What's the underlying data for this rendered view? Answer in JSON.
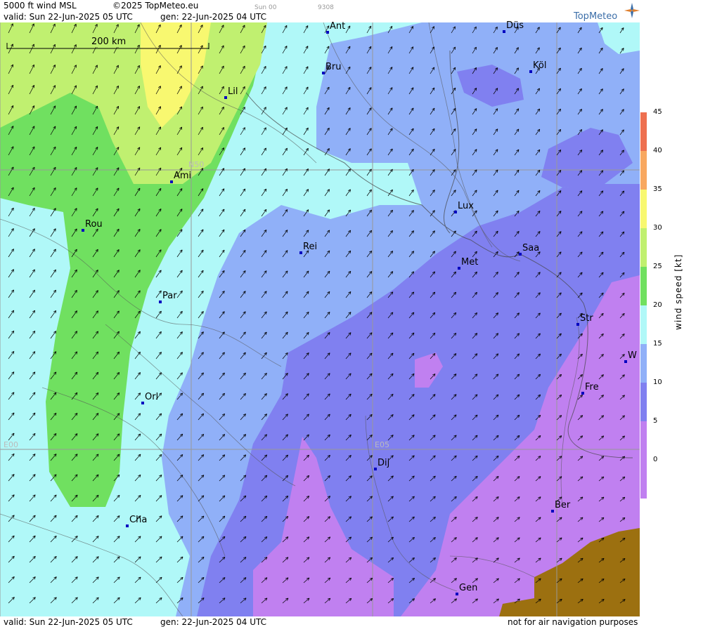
{
  "header": {
    "title": "5000 ft wind MSL",
    "copyright": "©2025 TopMeteo.eu",
    "valid": "valid:  Sun  22-Jun-2025  05 UTC",
    "gen": "gen: 22-Jun-2025 04 UTC",
    "small1": "Sun 00",
    "small2": "9308"
  },
  "footer": {
    "valid": "valid:  Sun  22-Jun-2025  05 UTC",
    "gen": "gen: 22-Jun-2025 04 UTC",
    "disclaimer": "not for air navigation purposes"
  },
  "logo": {
    "text": "TopMeteo"
  },
  "scale": {
    "label": "200 km"
  },
  "grid": {
    "n50": "N50",
    "e00": "E00",
    "e05": "E05"
  },
  "legend": {
    "title": "wind  speed  [kt]",
    "ticks": [
      "45",
      "40",
      "35",
      "30",
      "25",
      "20",
      "15",
      "10",
      "5",
      "0"
    ],
    "colors": [
      "#ee7050",
      "#f8a860",
      "#f8f870",
      "#c0f070",
      "#70e060",
      "#b0f8f8",
      "#90b0f8",
      "#8080f0",
      "#c080f0",
      "#c080f0"
    ]
  },
  "cities": [
    {
      "name": "Ant"
    },
    {
      "name": "Düs"
    },
    {
      "name": "Bru"
    },
    {
      "name": "Köl"
    },
    {
      "name": "Lil"
    },
    {
      "name": "Ami"
    },
    {
      "name": "Lux"
    },
    {
      "name": "Rou"
    },
    {
      "name": "Rei"
    },
    {
      "name": "Saa"
    },
    {
      "name": "Met"
    },
    {
      "name": "Par"
    },
    {
      "name": "Str"
    },
    {
      "name": "W"
    },
    {
      "name": "Fre"
    },
    {
      "name": "Orl"
    },
    {
      "name": "Dij"
    },
    {
      "name": "Ber"
    },
    {
      "name": "Cha"
    },
    {
      "name": "Gen"
    }
  ]
}
